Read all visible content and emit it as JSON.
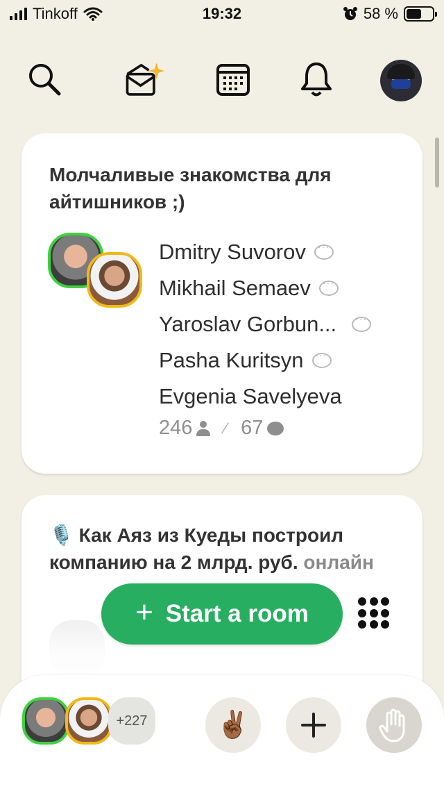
{
  "status_bar": {
    "carrier": "Tinkoff",
    "time": "19:32",
    "battery": "58 %",
    "battery_fraction": 0.58
  },
  "top_nav": {
    "icons": [
      "search-icon",
      "invite-envelope-icon",
      "calendar-icon",
      "bell-icon",
      "profile-avatar"
    ]
  },
  "rooms": [
    {
      "title": "Молчаливые знакомства для айтишников ;)",
      "speakers": [
        {
          "name": "Dmitry Suvorov",
          "chat": true
        },
        {
          "name": "Mikhail Semaev",
          "chat": true
        },
        {
          "name": "Yaroslav Gorbun...",
          "chat": true
        },
        {
          "name": "Pasha Kuritsyn",
          "chat": true
        },
        {
          "name": "Evgenia Savelyeva",
          "chat": false
        }
      ],
      "listeners": "246",
      "speakers_count": "67"
    },
    {
      "title_emoji": "🎙️",
      "title": "Как Аяз из Куеды построил компанию на 2 млрд. руб.",
      "title_muted": "онлайн"
    }
  ],
  "actions": {
    "start_room": "Start a room"
  },
  "bottom_bar": {
    "more_count": "+227",
    "wave_emoji": "✌🏾"
  }
}
